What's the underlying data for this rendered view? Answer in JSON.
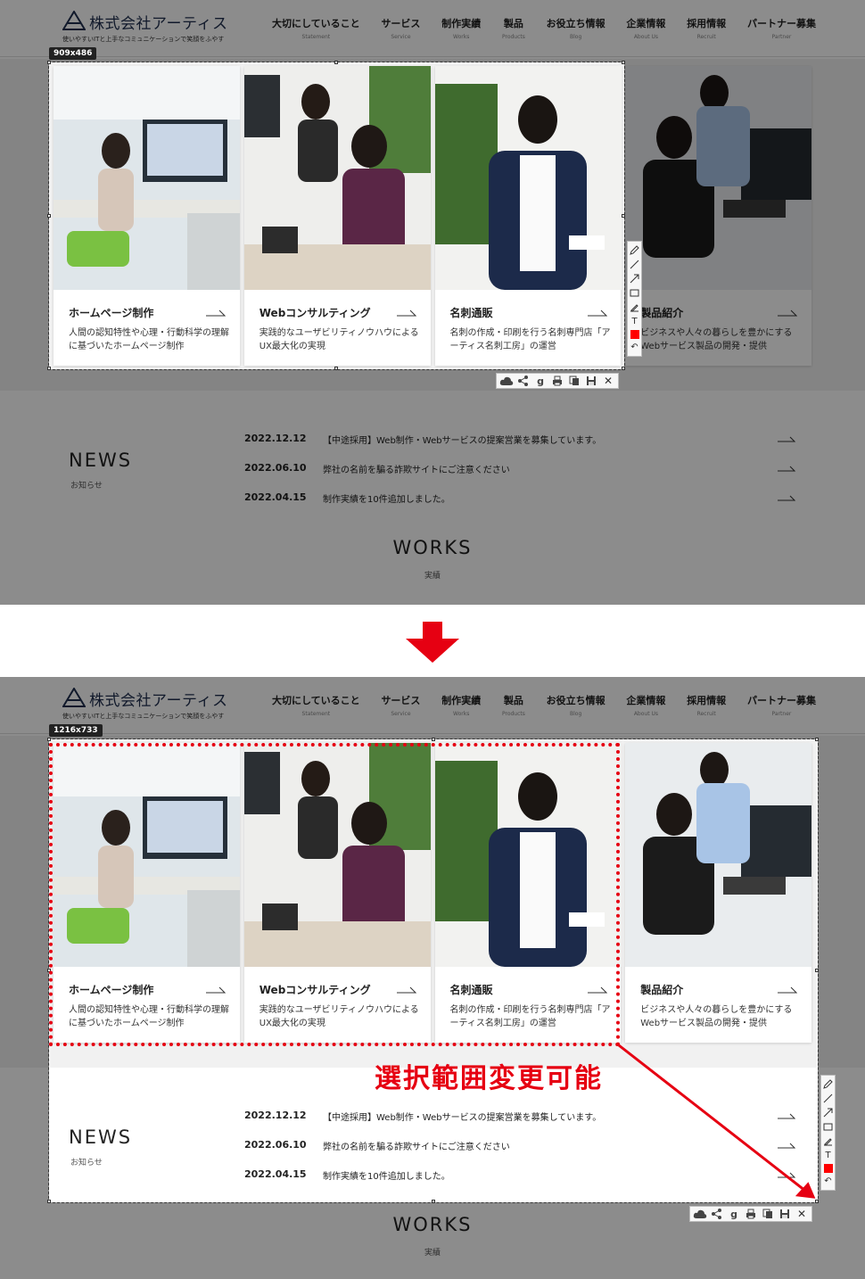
{
  "site": {
    "company_name": "株式会社アーティス",
    "tagline": "使いやすいITと上手なコミュニケーションで笑顔をふやす",
    "nav": [
      {
        "jp": "大切にしていること",
        "en": "Statement"
      },
      {
        "jp": "サービス",
        "en": "Service"
      },
      {
        "jp": "制作実績",
        "en": "Works"
      },
      {
        "jp": "製品",
        "en": "Products"
      },
      {
        "jp": "お役立ち情報",
        "en": "Blog"
      },
      {
        "jp": "企業情報",
        "en": "About Us"
      },
      {
        "jp": "採用情報",
        "en": "Recruit"
      },
      {
        "jp": "パートナー募集",
        "en": "Partner"
      }
    ],
    "cards": [
      {
        "title": "ホームページ制作",
        "desc": "人間の認知特性や心理・行動科学の理解に基づいたホームページ制作"
      },
      {
        "title": "Webコンサルティング",
        "desc": "実践的なユーザビリティノウハウによるUX最大化の実現"
      },
      {
        "title": "名刺通販",
        "desc": "名刺の作成・印刷を行う名刺専門店「アーティス名刺工房」の運営"
      },
      {
        "title": "製品紹介",
        "desc": "ビジネスや人々の暮らしを豊かにするWebサービス製品の開発・提供"
      }
    ],
    "news": {
      "heading": "NEWS",
      "sub": "お知らせ",
      "items": [
        {
          "date": "2022.12.12",
          "text": "【中途採用】Web制作・Webサービスの提案営業を募集しています。"
        },
        {
          "date": "2022.06.10",
          "text": "弊社の名前を騙る詐欺サイトにご注意ください"
        },
        {
          "date": "2022.04.15",
          "text": "制作実績を10件追加しました。"
        }
      ]
    },
    "works": {
      "heading": "WORKS",
      "sub": "実績"
    }
  },
  "capture": {
    "before_size": "909x486",
    "after_size": "1216x733",
    "annotation": "選択範囲変更可能",
    "side_tools": [
      "pencil-icon",
      "line-icon",
      "arrow-icon",
      "rectangle-icon",
      "marker-icon",
      "text-tool-icon",
      "color-swatch",
      "undo-icon"
    ],
    "bottom_tools": [
      "cloud-upload-icon",
      "share-icon",
      "google-icon",
      "print-icon",
      "copy-icon",
      "save-icon",
      "close-icon"
    ],
    "text_tool_label": "T",
    "undo_label": "↶",
    "google_label": "g",
    "close_label": "✕",
    "accent_color": "#e60012",
    "dim_color": "rgba(0,0,0,0.45)"
  }
}
